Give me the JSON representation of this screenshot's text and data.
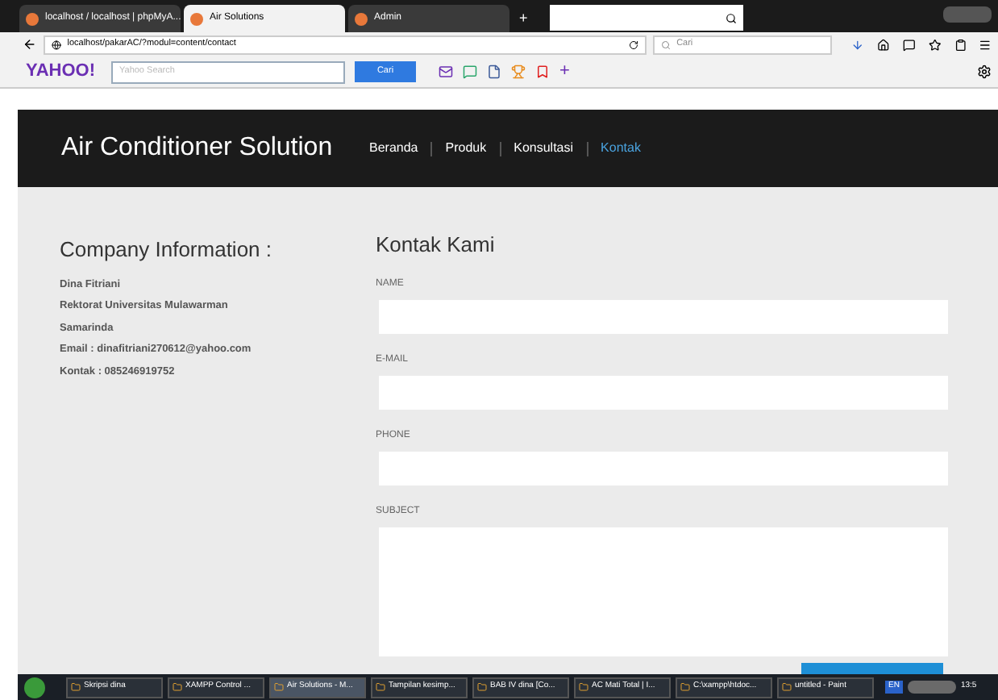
{
  "browser": {
    "tabs": [
      {
        "label": "localhost / localhost | phpMyA...",
        "selected": false
      },
      {
        "label": "Air Solutions",
        "selected": true
      },
      {
        "label": "Admin",
        "selected": false
      }
    ],
    "new_tab": "+",
    "address": "localhost/pakarAC/?modul=content/contact",
    "search_placeholder": "Cari"
  },
  "yahoo_toolbar": {
    "logo": "YAHOO!",
    "search_placeholder": "Yahoo Search",
    "button": "Cari",
    "add": "+"
  },
  "site": {
    "title": "Air Conditioner Solution",
    "nav": [
      {
        "label": "Beranda",
        "selected": false
      },
      {
        "label": "Produk",
        "selected": false
      },
      {
        "label": "Konsultasi",
        "selected": false
      },
      {
        "label": "Kontak",
        "selected": true
      }
    ]
  },
  "company": {
    "heading": "Company Information :",
    "lines": [
      "Dina Fitriani",
      "Rektorat Universitas Mulawarman",
      "Samarinda",
      "Email : dinafitriani270612@yahoo.com",
      "Kontak : 085246919752"
    ]
  },
  "contact_form": {
    "heading": "Kontak Kami",
    "fields": [
      {
        "label": "NAME",
        "kind": "input"
      },
      {
        "label": "E-MAIL",
        "kind": "input"
      },
      {
        "label": "PHONE",
        "kind": "input"
      },
      {
        "label": "SUBJECT",
        "kind": "textarea"
      }
    ]
  },
  "taskbar": {
    "items": [
      {
        "label": "Skripsi dina",
        "selected": false
      },
      {
        "label": "XAMPP Control ...",
        "selected": false
      },
      {
        "label": "Air Solutions - M...",
        "selected": true
      },
      {
        "label": "Tampilan kesimp...",
        "selected": false
      },
      {
        "label": "BAB IV dina [Co...",
        "selected": false
      },
      {
        "label": "AC Mati Total | I...",
        "selected": false
      },
      {
        "label": "C:\\xampp\\htdoc...",
        "selected": false
      },
      {
        "label": "untitled - Paint",
        "selected": false
      }
    ],
    "language": "EN",
    "time": "13:5"
  }
}
